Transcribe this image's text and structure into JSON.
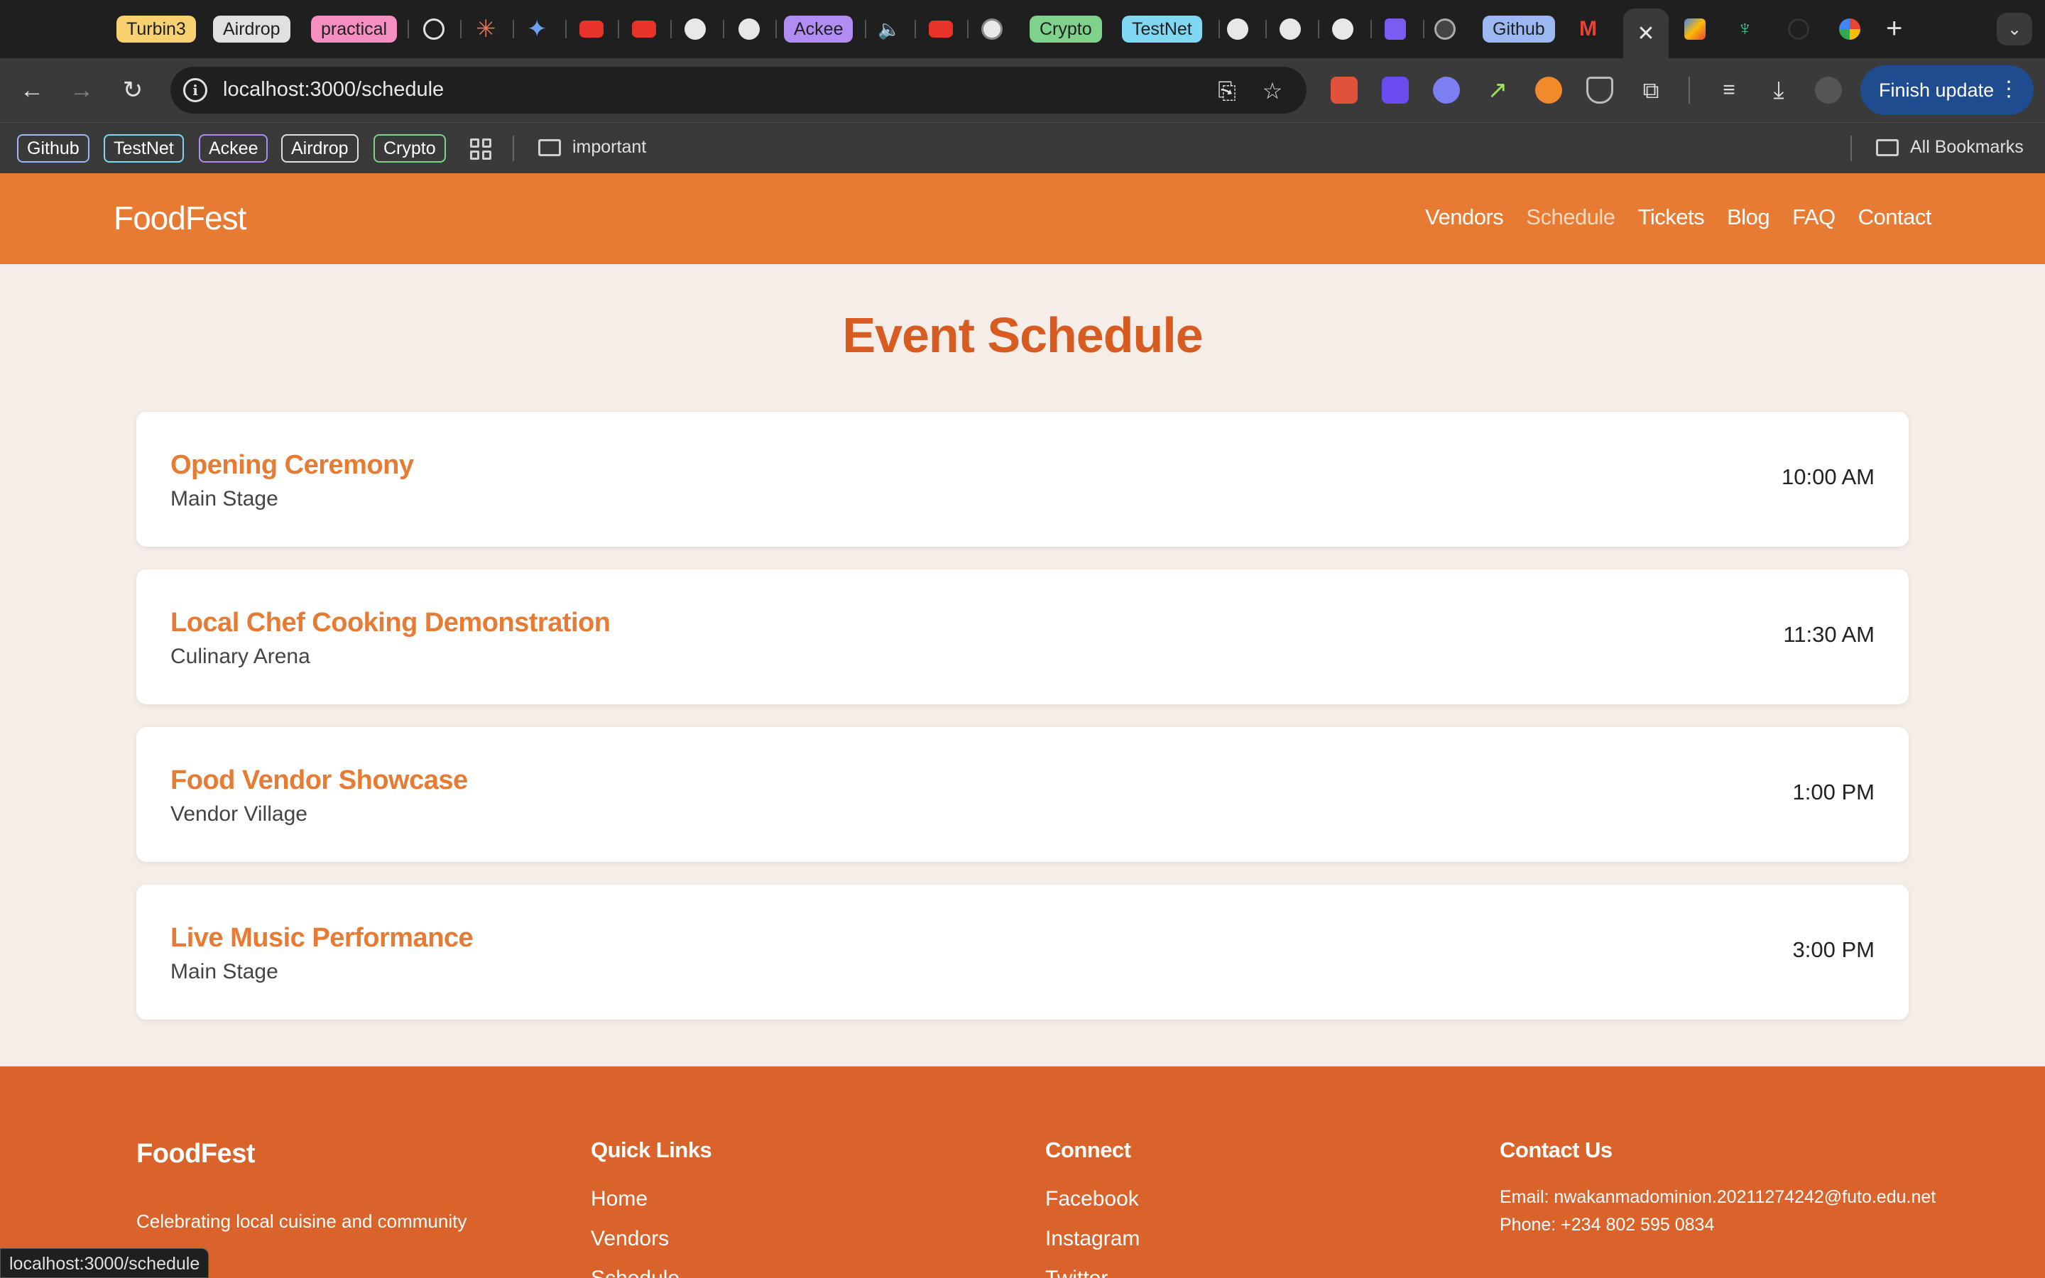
{
  "browser": {
    "tabs": [
      {
        "type": "chip",
        "label": "Turbin3",
        "color": "#f7d070"
      },
      {
        "type": "chip",
        "label": "Airdrop",
        "color": "#e0e0e0"
      },
      {
        "type": "chip",
        "label": "practical",
        "color": "#f58fc2"
      },
      {
        "type": "icon",
        "icon": "openai-icon"
      },
      {
        "type": "icon",
        "icon": "claude-icon"
      },
      {
        "type": "icon",
        "icon": "gemini-icon"
      },
      {
        "type": "icon",
        "icon": "youtube-icon"
      },
      {
        "type": "icon",
        "icon": "youtube-icon"
      },
      {
        "type": "icon",
        "icon": "github-icon"
      },
      {
        "type": "icon",
        "icon": "github-icon"
      },
      {
        "type": "chip",
        "label": "Ackee",
        "color": "#b18cf2"
      },
      {
        "type": "icon",
        "icon": "speaker-icon"
      },
      {
        "type": "icon",
        "icon": "youtube-icon"
      },
      {
        "type": "icon",
        "icon": "github-icon"
      },
      {
        "type": "chip",
        "label": "Crypto",
        "color": "#7fd18b"
      },
      {
        "type": "chip",
        "label": "TestNet",
        "color": "#7fd7f2"
      },
      {
        "type": "icon",
        "icon": "github-icon"
      },
      {
        "type": "icon",
        "icon": "github-icon"
      },
      {
        "type": "icon",
        "icon": "github-icon"
      },
      {
        "type": "icon",
        "icon": "app-icon"
      },
      {
        "type": "icon",
        "icon": "app-icon"
      },
      {
        "type": "chip",
        "label": "Github",
        "color": "#9bb8f2"
      },
      {
        "type": "icon",
        "icon": "gmail-icon"
      }
    ],
    "address": "localhost:3000/schedule",
    "finish_update_label": "Finish update",
    "bookmarks": [
      {
        "label": "Github",
        "color": "#9bb8f2"
      },
      {
        "label": "TestNet",
        "color": "#7fd7f2"
      },
      {
        "label": "Ackee",
        "color": "#b18cf2"
      },
      {
        "label": "Airdrop",
        "color": "#e0e0e0"
      },
      {
        "label": "Crypto",
        "color": "#7fd18b"
      }
    ],
    "bookmark_folder": "important",
    "all_bookmarks": "All Bookmarks",
    "status_url": "localhost:3000/schedule"
  },
  "site": {
    "brand": "FoodFest",
    "nav": [
      "Vendors",
      "Schedule",
      "Tickets",
      "Blog",
      "FAQ",
      "Contact"
    ],
    "active_nav": "Schedule"
  },
  "main": {
    "title": "Event Schedule",
    "events": [
      {
        "title": "Opening Ceremony",
        "venue": "Main Stage",
        "time": "10:00 AM"
      },
      {
        "title": "Local Chef Cooking Demonstration",
        "venue": "Culinary Arena",
        "time": "11:30 AM"
      },
      {
        "title": "Food Vendor Showcase",
        "venue": "Vendor Village",
        "time": "1:00 PM"
      },
      {
        "title": "Live Music Performance",
        "venue": "Main Stage",
        "time": "3:00 PM"
      }
    ]
  },
  "footer": {
    "brand": "FoodFest",
    "tagline": "Celebrating local cuisine and community",
    "quick_links_title": "Quick Links",
    "quick_links": [
      "Home",
      "Vendors",
      "Schedule"
    ],
    "connect_title": "Connect",
    "connect": [
      "Facebook",
      "Instagram",
      "Twitter"
    ],
    "contact_title": "Contact Us",
    "email": "Email: nwakanmadominion.20211274242@futo.edu.net",
    "phone": "Phone: +234 802 595 0834"
  },
  "colors": {
    "header": "#e77b33",
    "footer": "#d9632b",
    "title": "#d85c22",
    "background": "#f5ede8"
  }
}
